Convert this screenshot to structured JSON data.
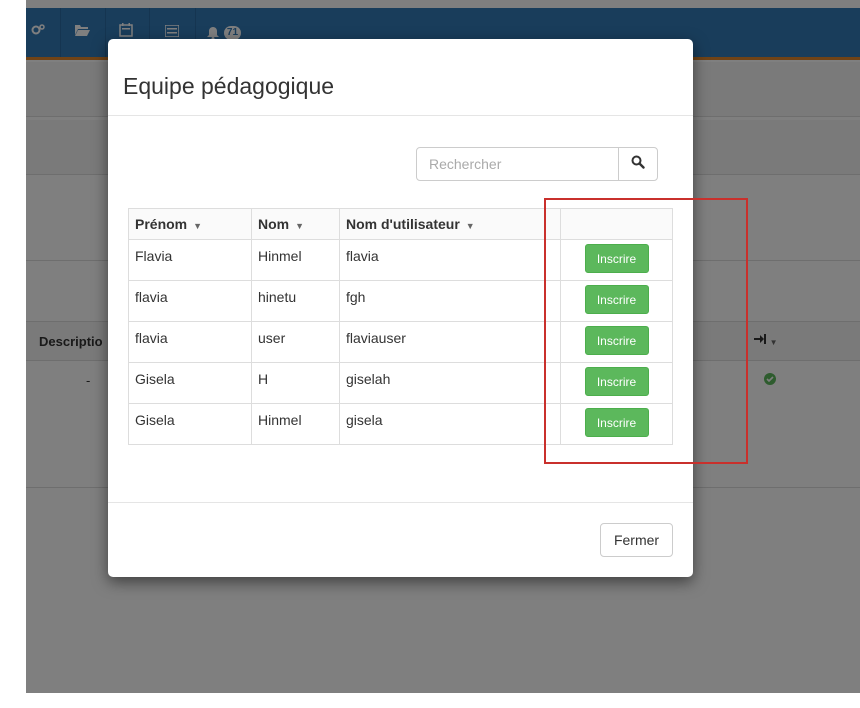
{
  "topbar": {
    "icons": [
      "cogs-icon",
      "folder-open-icon",
      "calendar-icon",
      "list-icon",
      "bell-icon"
    ],
    "notification_count": "71"
  },
  "background": {
    "description_header": "Descriptio",
    "dash": "-",
    "login_header_icon": "sign-in-icon",
    "status_icon": "check-circle-icon"
  },
  "modal": {
    "title": "Equipe pédagogique",
    "search": {
      "placeholder": "Rechercher",
      "button_icon": "search-icon"
    },
    "table": {
      "columns": [
        "Prénom",
        "Nom",
        "Nom d'utilisateur",
        ""
      ],
      "rows": [
        {
          "prenom": "Flavia",
          "nom": "Hinmel",
          "username": "flavia",
          "action": "Inscrire"
        },
        {
          "prenom": "flavia",
          "nom": "hinetu",
          "username": "fgh",
          "action": "Inscrire"
        },
        {
          "prenom": "flavia",
          "nom": "user",
          "username": "flaviauser",
          "action": "Inscrire"
        },
        {
          "prenom": "Gisela",
          "nom": "H",
          "username": "giselah",
          "action": "Inscrire"
        },
        {
          "prenom": "Gisela",
          "nom": "Hinmel",
          "username": "gisela",
          "action": "Inscrire"
        }
      ]
    },
    "close_label": "Fermer"
  },
  "colors": {
    "topbar": "#337ab7",
    "accent": "#e0872c",
    "success": "#5cb85c",
    "highlight": "#c9302c"
  }
}
